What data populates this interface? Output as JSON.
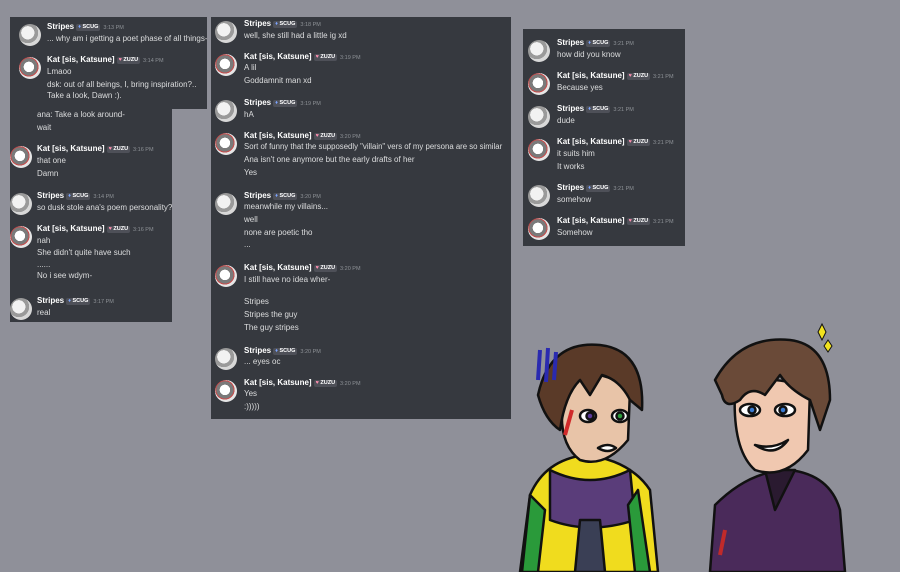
{
  "panel1": {
    "messages": [
      {
        "author": "Stripes",
        "tag": "SCUG",
        "time": "3:13 PM",
        "lines": [
          "... why am i getting a poet phase of all things-"
        ]
      },
      {
        "author": "Kat [sis, Katsune]",
        "tag": "ZUZU",
        "time": "3:14 PM",
        "lines": [
          "Lmaoo",
          "dsk: out of all beings, I, bring inspiration?..",
          "Take a look, Dawn :)."
        ]
      }
    ]
  },
  "panel2": {
    "lines_top": [
      "ana: Take a look around-",
      "wait"
    ],
    "messages": [
      {
        "author": "Kat [sis, Katsune]",
        "tag": "ZUZU",
        "time": "3:16 PM",
        "lines": [
          "that one",
          "Damn"
        ]
      },
      {
        "author": "Stripes",
        "tag": "SCUG",
        "time": "3:14 PM",
        "lines": [
          "so dusk stole ana's poem personality?"
        ]
      },
      {
        "author": "Kat [sis, Katsune]",
        "tag": "ZUZU",
        "time": "3:16 PM",
        "lines": [
          "nah",
          "She didn't quite have such",
          "......",
          "No i see wdym-"
        ]
      },
      {
        "author": "Stripes",
        "tag": "SCUG",
        "time": "3:17 PM",
        "lines": [
          "real"
        ]
      }
    ]
  },
  "panel3": {
    "messages": [
      {
        "author": "Stripes",
        "tag": "SCUG",
        "time": "3:18 PM",
        "lines": [
          "well, she still had a little ig xd"
        ]
      },
      {
        "author": "Kat [sis, Katsune]",
        "tag": "ZUZU",
        "time": "3:19 PM",
        "lines": [
          "A lil",
          "Goddamnit man xd"
        ]
      },
      {
        "author": "Stripes",
        "tag": "SCUG",
        "time": "3:19 PM",
        "lines": [
          "hA"
        ]
      },
      {
        "author": "Kat [sis, Katsune]",
        "tag": "ZUZU",
        "time": "3:20 PM",
        "lines": [
          "Sort of funny that the supposedly \"villain\" vers of my persona are so similar",
          "Ana isn't one anymore but the early drafts of her",
          "Yes"
        ]
      },
      {
        "author": "Stripes",
        "tag": "SCUG",
        "time": "3:20 PM",
        "lines": [
          "meanwhile my villains...",
          "well",
          "none are poetic tho",
          "..."
        ]
      },
      {
        "author": "Kat [sis, Katsune]",
        "tag": "ZUZU",
        "time": "3:20 PM",
        "lines": [
          "I still have no idea wher-",
          "",
          "Stripes",
          "Stripes the guy",
          "The guy stripes"
        ]
      },
      {
        "author": "Stripes",
        "tag": "SCUG",
        "time": "3:20 PM",
        "lines": [
          "... eyes oc"
        ]
      },
      {
        "author": "Kat [sis, Katsune]",
        "tag": "ZUZU",
        "time": "3:20 PM",
        "lines": [
          "Yes",
          ":)))))"
        ]
      }
    ]
  },
  "panel4": {
    "messages": [
      {
        "author": "Stripes",
        "tag": "SCUG",
        "time": "3:21 PM",
        "lines": [
          "how did you know"
        ]
      },
      {
        "author": "Kat [sis, Katsune]",
        "tag": "ZUZU",
        "time": "3:21 PM",
        "lines": [
          "Because yes"
        ]
      },
      {
        "author": "Stripes",
        "tag": "SCUG",
        "time": "3:21 PM",
        "lines": [
          "dude"
        ]
      },
      {
        "author": "Kat [sis, Katsune]",
        "tag": "ZUZU",
        "time": "3:21 PM",
        "lines": [
          "it suits him",
          "It works"
        ]
      },
      {
        "author": "Stripes",
        "tag": "SCUG",
        "time": "3:21 PM",
        "lines": [
          "somehow"
        ]
      },
      {
        "author": "Kat [sis, Katsune]",
        "tag": "ZUZU",
        "time": "3:21 PM",
        "lines": [
          "Somehow"
        ]
      }
    ]
  },
  "colors": {
    "page_bg": "#8f9099",
    "panel_bg": "#36393f",
    "text": "#dcddde",
    "name": "#ffffff",
    "time": "#8e9297"
  },
  "icons": {
    "scug_tag": "drop-icon",
    "zuzu_tag": "heart-icon"
  }
}
